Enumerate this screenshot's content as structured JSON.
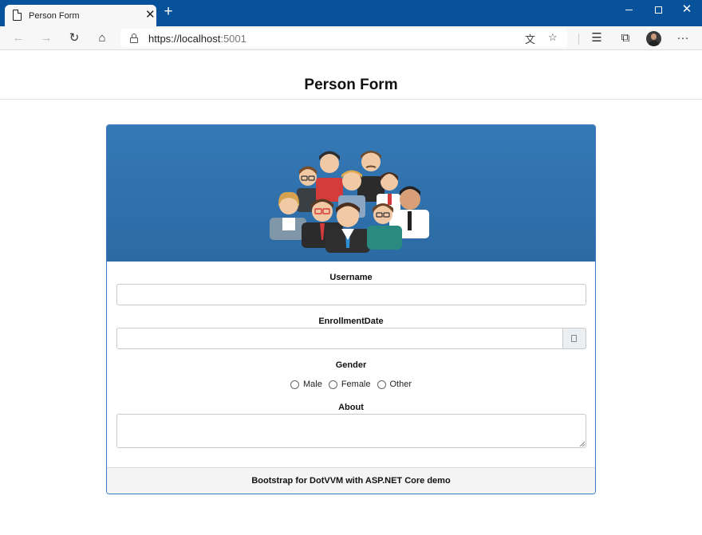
{
  "browser": {
    "tab_title": "Person Form",
    "tab_close": "✕",
    "new_tab": "+",
    "url_main": "https://localhost",
    "url_port": ":5001"
  },
  "page": {
    "title": "Person Form"
  },
  "form": {
    "username_label": "Username",
    "username_value": "",
    "enrollment_label": "EnrollmentDate",
    "enrollment_value": "",
    "gender_label": "Gender",
    "gender_options": [
      "Male",
      "Female",
      "Other"
    ],
    "about_label": "About",
    "about_value": ""
  },
  "footer": {
    "text": "Bootstrap for DotVVM with ASP.NET Core demo"
  },
  "colors": {
    "titlebar": "#07529a",
    "card_header": "#2f72ae",
    "card_border": "#3b7cc0"
  }
}
